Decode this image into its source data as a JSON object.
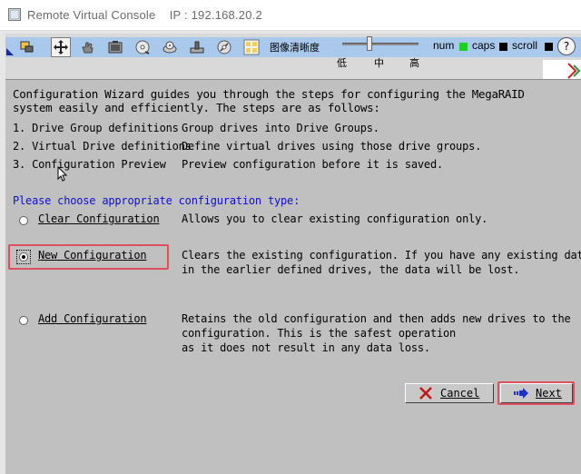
{
  "window": {
    "title": "Remote Virtual Console",
    "ip_label": "IP : 192.168.20.2"
  },
  "toolbar": {
    "icons": [
      "keyboard-mouse-icon",
      "move-icon",
      "hand-icon",
      "screenshot-icon",
      "cd-icon",
      "floppy-icon",
      "usb-drive-icon",
      "disk-image-icon",
      "keyboard-layout-icon"
    ],
    "clarity_label": "图像清晰度",
    "slider_ticks": [
      "低",
      "中",
      "高"
    ],
    "num_label": "num",
    "caps_label": "caps",
    "scroll_label": "scroll",
    "num_color": "#22cc22",
    "caps_color": "#000000",
    "scroll_color": "#000000",
    "help_label": "?"
  },
  "wizard": {
    "intro_line1": "Configuration Wizard guides you through the steps for configuring the MegaRAID",
    "intro_line2": "system easily and efficiently. The steps are as follows:",
    "steps": [
      {
        "name": "1. Drive Group definitions",
        "desc": "Group drives into Drive Groups."
      },
      {
        "name": "2. Virtual Drive definitions",
        "desc": "Define virtual drives using those drive groups."
      },
      {
        "name": "3. Configuration Preview",
        "desc": "Preview configuration before it is saved."
      }
    ],
    "prompt": "Please choose appropriate configuration type:",
    "options": [
      {
        "label": "Clear Configuration",
        "selected": false,
        "desc": [
          "Allows you to clear existing configuration only."
        ]
      },
      {
        "label": "New Configuration",
        "selected": true,
        "desc": [
          "Clears the existing configuration. If you have any existing data",
          "in the earlier defined drives, the data will be lost."
        ]
      },
      {
        "label": "Add Configuration",
        "selected": false,
        "desc": [
          "Retains the old configuration and then adds new drives to the",
          "configuration. This is the safest operation",
          "as it does not result in any data loss."
        ]
      }
    ],
    "cancel_label": "Cancel",
    "next_label": "Next",
    "highlight_color": "#e0505c",
    "prompt_color": "#1010c8"
  }
}
